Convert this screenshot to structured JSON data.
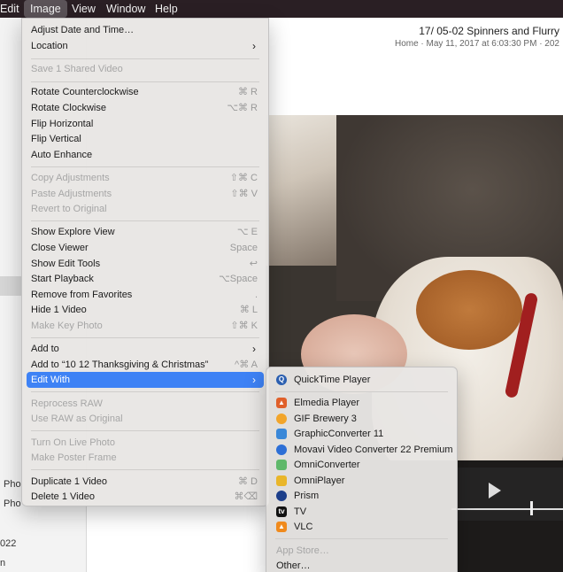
{
  "menubar": {
    "items": [
      {
        "label": "Edit",
        "active": false
      },
      {
        "label": "Image",
        "active": true
      },
      {
        "label": "View",
        "active": false
      },
      {
        "label": "Window",
        "active": false
      },
      {
        "label": "Help",
        "active": false
      }
    ]
  },
  "window": {
    "title": "17/ 05-02 Spinners and Flurry",
    "subtitle": "Home  ·  May 11, 2017 at 6:03:30 PM  ·  202",
    "sidebar_texts": [
      "Pho",
      "Pho",
      "022",
      "n"
    ]
  },
  "image_menu": {
    "items": [
      {
        "label": "Adjust Date and Time…",
        "shortcut": "",
        "disabled": false,
        "submenu": false
      },
      {
        "label": "Location",
        "shortcut": "",
        "disabled": false,
        "submenu": true
      },
      {
        "label": "Save 1 Shared Video",
        "shortcut": "",
        "disabled": true,
        "submenu": false
      },
      {
        "label": "Rotate Counterclockwise",
        "shortcut": "⌘ R",
        "disabled": false,
        "submenu": false
      },
      {
        "label": "Rotate Clockwise",
        "shortcut": "⌥⌘ R",
        "disabled": false,
        "submenu": false
      },
      {
        "label": "Flip Horizontal",
        "shortcut": "",
        "disabled": false,
        "submenu": false
      },
      {
        "label": "Flip Vertical",
        "shortcut": "",
        "disabled": false,
        "submenu": false
      },
      {
        "label": "Auto Enhance",
        "shortcut": "",
        "disabled": false,
        "submenu": false
      },
      {
        "label": "Copy Adjustments",
        "shortcut": "⇧⌘ C",
        "disabled": true,
        "submenu": false
      },
      {
        "label": "Paste Adjustments",
        "shortcut": "⇧⌘ V",
        "disabled": true,
        "submenu": false
      },
      {
        "label": "Revert to Original",
        "shortcut": "",
        "disabled": true,
        "submenu": false
      },
      {
        "label": "Show Explore View",
        "shortcut": "⌥ E",
        "disabled": false,
        "submenu": false
      },
      {
        "label": "Close Viewer",
        "shortcut": "Space",
        "disabled": false,
        "submenu": false
      },
      {
        "label": "Show Edit Tools",
        "shortcut": "↩",
        "disabled": false,
        "submenu": false
      },
      {
        "label": "Start Playback",
        "shortcut": "⌥Space",
        "disabled": false,
        "submenu": false
      },
      {
        "label": "Remove from Favorites",
        "shortcut": ".",
        "disabled": false,
        "submenu": false
      },
      {
        "label": "Hide 1 Video",
        "shortcut": "⌘ L",
        "disabled": false,
        "submenu": false
      },
      {
        "label": "Make Key Photo",
        "shortcut": "⇧⌘ K",
        "disabled": true,
        "submenu": false
      },
      {
        "label": "Add to",
        "shortcut": "",
        "disabled": false,
        "submenu": true
      },
      {
        "label": "Add to “10 12 Thanksgiving & Christmas”",
        "shortcut": "^⌘ A",
        "disabled": false,
        "submenu": false
      },
      {
        "label": "Edit With",
        "shortcut": "",
        "disabled": false,
        "submenu": true,
        "highlight": true
      },
      {
        "label": "Reprocess RAW",
        "shortcut": "",
        "disabled": true,
        "submenu": false
      },
      {
        "label": "Use RAW as Original",
        "shortcut": "",
        "disabled": true,
        "submenu": false
      },
      {
        "label": "Turn On Live Photo",
        "shortcut": "",
        "disabled": true,
        "submenu": false
      },
      {
        "label": "Make Poster Frame",
        "shortcut": "",
        "disabled": true,
        "submenu": false
      },
      {
        "label": "Duplicate 1 Video",
        "shortcut": "⌘ D",
        "disabled": false,
        "submenu": false
      },
      {
        "label": "Delete 1 Video",
        "shortcut": "⌘⌫",
        "disabled": false,
        "submenu": false
      }
    ]
  },
  "editwith_menu": {
    "items": [
      {
        "label": "QuickTime Player",
        "icon": "quicktime-icon",
        "color": "#2b5fb0",
        "disabled": false
      },
      {
        "label": "Elmedia Player",
        "icon": "elmedia-icon",
        "color": "#e0602a",
        "disabled": false
      },
      {
        "label": "GIF Brewery 3",
        "icon": "gif-brewery-icon",
        "color": "#f2a52a",
        "disabled": false
      },
      {
        "label": "GraphicConverter 11",
        "icon": "graphicconverter-icon",
        "color": "#3a88d8",
        "disabled": false
      },
      {
        "label": "Movavi Video Converter 22 Premium",
        "icon": "movavi-icon",
        "color": "#2d6fd6",
        "disabled": false
      },
      {
        "label": "OmniConverter",
        "icon": "omniconverter-icon",
        "color": "#5fb86a",
        "disabled": false
      },
      {
        "label": "OmniPlayer",
        "icon": "omniplayer-icon",
        "color": "#e9b62a",
        "disabled": false
      },
      {
        "label": "Prism",
        "icon": "prism-icon",
        "color": "#1d3f8a",
        "disabled": false
      },
      {
        "label": "TV",
        "icon": "tv-icon",
        "color": "#111111",
        "disabled": false
      },
      {
        "label": "VLC",
        "icon": "vlc-icon",
        "color": "#f08a1c",
        "disabled": false
      },
      {
        "label": "App Store…",
        "icon": "",
        "color": "",
        "disabled": true
      },
      {
        "label": "Other…",
        "icon": "",
        "color": "",
        "disabled": false
      }
    ]
  }
}
